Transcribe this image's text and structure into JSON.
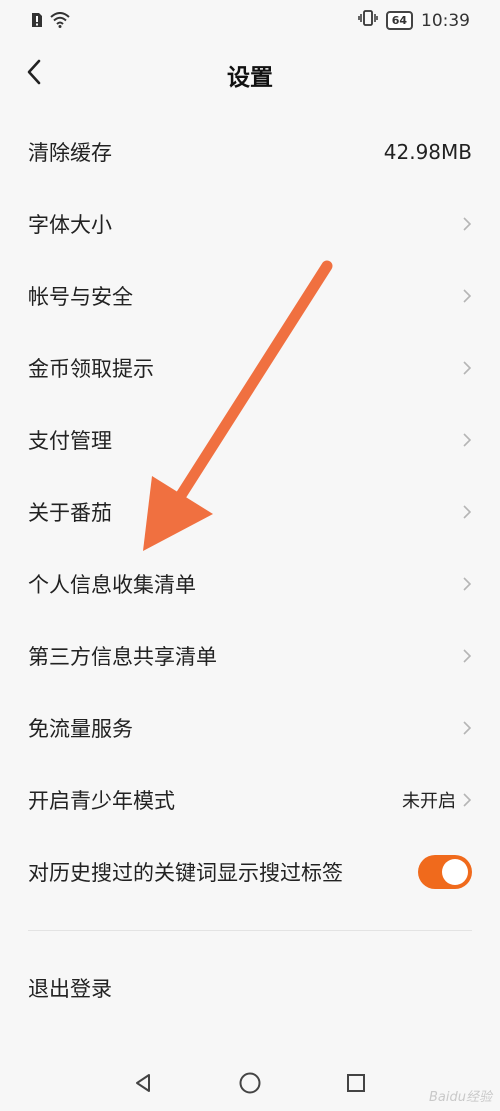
{
  "status_bar": {
    "time": "10:39",
    "battery": "64"
  },
  "header": {
    "title": "设置"
  },
  "settings": {
    "items": [
      {
        "label": "清除缓存",
        "value": "42.98MB"
      },
      {
        "label": "字体大小"
      },
      {
        "label": "帐号与安全"
      },
      {
        "label": "金币领取提示"
      },
      {
        "label": "支付管理"
      },
      {
        "label": "关于番茄"
      },
      {
        "label": "个人信息收集清单"
      },
      {
        "label": "第三方信息共享清单"
      },
      {
        "label": "免流量服务"
      },
      {
        "label": "开启青少年模式",
        "value": "未开启"
      },
      {
        "label": "对历史搜过的关键词显示搜过标签",
        "toggle_on": true
      }
    ],
    "logout_label": "退出登录"
  },
  "colors": {
    "accent": "#f06a1c",
    "annotation_arrow": "#f07040"
  },
  "icons": {
    "back": "chevron-left-icon",
    "row_arrow": "chevron-right-icon",
    "nav_back": "triangle-back-icon",
    "nav_home": "circle-home-icon",
    "nav_recent": "square-recent-icon"
  },
  "watermark": "Baidu经验"
}
